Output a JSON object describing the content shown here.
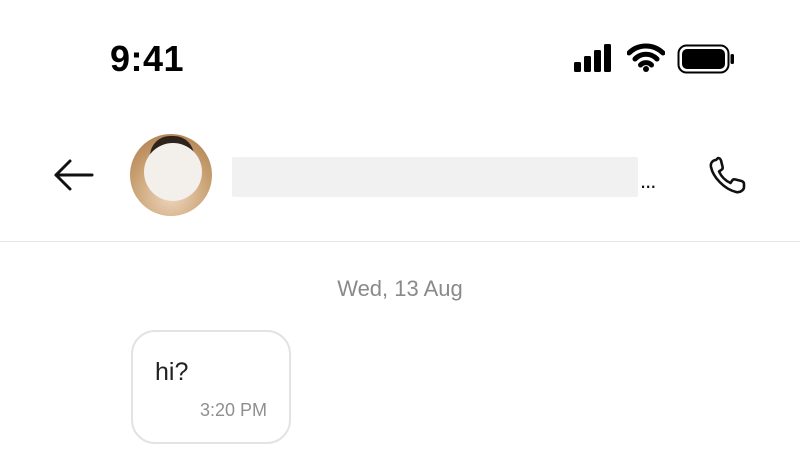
{
  "status_bar": {
    "time": "9:41",
    "icons": [
      "signal-icon",
      "wifi-icon",
      "battery-icon"
    ]
  },
  "header": {
    "back_icon": "back-arrow-icon",
    "contact_name": "",
    "contact_name_redacted": true,
    "more_indicator": "...",
    "call_icon": "phone-icon"
  },
  "conversation": {
    "date_label": "Wed, 13 Aug",
    "messages": [
      {
        "text": "hi?",
        "time": "3:20 PM",
        "direction": "incoming"
      }
    ]
  },
  "colors": {
    "background": "#ffffff",
    "bubble_border": "#e3e3e3",
    "secondary_text": "#8a8a8a",
    "divider": "#e6e6e6"
  }
}
